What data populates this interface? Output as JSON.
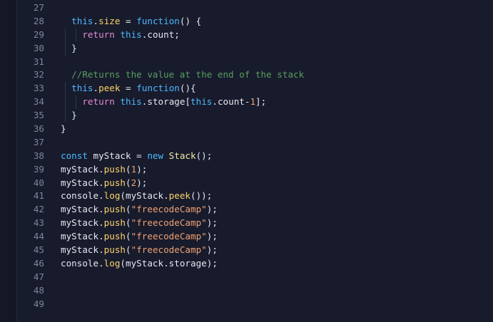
{
  "editor": {
    "lines": [
      {
        "n": "27",
        "tokens": []
      },
      {
        "n": "28",
        "tokens": [
          {
            "t": "  ",
            "c": "plain"
          },
          {
            "t": "this",
            "c": "kw"
          },
          {
            "t": ".",
            "c": "plain"
          },
          {
            "t": "size",
            "c": "prop"
          },
          {
            "t": " = ",
            "c": "op"
          },
          {
            "t": "function",
            "c": "kw"
          },
          {
            "t": "() {",
            "c": "plain"
          }
        ]
      },
      {
        "n": "29",
        "tokens": [
          {
            "t": "    ",
            "c": "plain"
          },
          {
            "t": "return",
            "c": "ret"
          },
          {
            "t": " ",
            "c": "plain"
          },
          {
            "t": "this",
            "c": "kw"
          },
          {
            "t": ".count;",
            "c": "plain"
          }
        ]
      },
      {
        "n": "30",
        "tokens": [
          {
            "t": "  }",
            "c": "plain"
          }
        ]
      },
      {
        "n": "31",
        "tokens": []
      },
      {
        "n": "32",
        "tokens": [
          {
            "t": "  //Returns the value at the end of the stack",
            "c": "cm"
          }
        ]
      },
      {
        "n": "33",
        "tokens": [
          {
            "t": "  ",
            "c": "plain"
          },
          {
            "t": "this",
            "c": "kw"
          },
          {
            "t": ".",
            "c": "plain"
          },
          {
            "t": "peek",
            "c": "prop"
          },
          {
            "t": " = ",
            "c": "op"
          },
          {
            "t": "function",
            "c": "kw"
          },
          {
            "t": "(){",
            "c": "plain"
          }
        ]
      },
      {
        "n": "34",
        "tokens": [
          {
            "t": "    ",
            "c": "plain"
          },
          {
            "t": "return",
            "c": "ret"
          },
          {
            "t": " ",
            "c": "plain"
          },
          {
            "t": "this",
            "c": "kw"
          },
          {
            "t": ".storage[",
            "c": "plain"
          },
          {
            "t": "this",
            "c": "kw"
          },
          {
            "t": ".count-",
            "c": "plain"
          },
          {
            "t": "1",
            "c": "num"
          },
          {
            "t": "];",
            "c": "plain"
          }
        ]
      },
      {
        "n": "35",
        "tokens": [
          {
            "t": "  }",
            "c": "plain"
          }
        ]
      },
      {
        "n": "36",
        "tokens": [
          {
            "t": "}",
            "c": "plain"
          }
        ]
      },
      {
        "n": "37",
        "tokens": []
      },
      {
        "n": "38",
        "tokens": [
          {
            "t": "const",
            "c": "kw"
          },
          {
            "t": " myStack = ",
            "c": "plain"
          },
          {
            "t": "new",
            "c": "kw"
          },
          {
            "t": " ",
            "c": "plain"
          },
          {
            "t": "Stack",
            "c": "cls"
          },
          {
            "t": "();",
            "c": "plain"
          }
        ]
      },
      {
        "n": "39",
        "tokens": [
          {
            "t": "myStack.",
            "c": "plain"
          },
          {
            "t": "push",
            "c": "fn"
          },
          {
            "t": "(",
            "c": "plain"
          },
          {
            "t": "1",
            "c": "num"
          },
          {
            "t": ");",
            "c": "plain"
          }
        ]
      },
      {
        "n": "40",
        "tokens": [
          {
            "t": "myStack.",
            "c": "plain"
          },
          {
            "t": "push",
            "c": "fn"
          },
          {
            "t": "(",
            "c": "plain"
          },
          {
            "t": "2",
            "c": "num"
          },
          {
            "t": ");",
            "c": "plain"
          }
        ]
      },
      {
        "n": "41",
        "tokens": [
          {
            "t": "console.",
            "c": "plain"
          },
          {
            "t": "log",
            "c": "fn"
          },
          {
            "t": "(myStack.",
            "c": "plain"
          },
          {
            "t": "peek",
            "c": "fn"
          },
          {
            "t": "());",
            "c": "plain"
          }
        ]
      },
      {
        "n": "42",
        "tokens": [
          {
            "t": "myStack.",
            "c": "plain"
          },
          {
            "t": "push",
            "c": "fn"
          },
          {
            "t": "(",
            "c": "plain"
          },
          {
            "t": "\"freecodeCamp\"",
            "c": "str"
          },
          {
            "t": ");",
            "c": "plain"
          }
        ]
      },
      {
        "n": "43",
        "tokens": [
          {
            "t": "myStack.",
            "c": "plain"
          },
          {
            "t": "push",
            "c": "fn"
          },
          {
            "t": "(",
            "c": "plain"
          },
          {
            "t": "\"freecodeCamp\"",
            "c": "str"
          },
          {
            "t": ");",
            "c": "plain"
          }
        ]
      },
      {
        "n": "44",
        "tokens": [
          {
            "t": "myStack.",
            "c": "plain"
          },
          {
            "t": "push",
            "c": "fn"
          },
          {
            "t": "(",
            "c": "plain"
          },
          {
            "t": "\"freecodeCamp\"",
            "c": "str"
          },
          {
            "t": ");",
            "c": "plain"
          }
        ]
      },
      {
        "n": "45",
        "tokens": [
          {
            "t": "myStack.",
            "c": "plain"
          },
          {
            "t": "push",
            "c": "fn"
          },
          {
            "t": "(",
            "c": "plain"
          },
          {
            "t": "\"freecodeCamp\"",
            "c": "str"
          },
          {
            "t": ");",
            "c": "plain"
          }
        ]
      },
      {
        "n": "46",
        "tokens": [
          {
            "t": "console.",
            "c": "plain"
          },
          {
            "t": "log",
            "c": "fn"
          },
          {
            "t": "(myStack.storage);",
            "c": "plain"
          }
        ]
      },
      {
        "n": "47",
        "tokens": []
      },
      {
        "n": "48",
        "tokens": []
      },
      {
        "n": "49",
        "tokens": []
      }
    ]
  },
  "colors": {
    "background": "#171b2c",
    "keyword": "#4fb8ff",
    "return": "#e68ad0",
    "property": "#ffd36b",
    "string": "#f0a173",
    "comment": "#5a9e5f",
    "line_number": "#7f869b"
  }
}
